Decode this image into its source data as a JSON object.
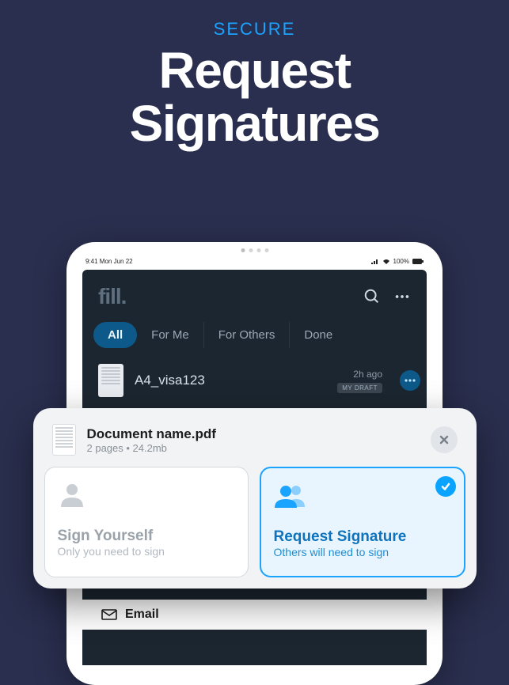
{
  "headline": {
    "eyebrow": "SECURE",
    "line1": "Request",
    "line2": "Signatures"
  },
  "statusbar": {
    "time": "9:41  Mon Jun 22",
    "battery": "100%"
  },
  "app": {
    "brand": "fill",
    "brandDot": "."
  },
  "tabs": [
    "All",
    "For Me",
    "For Others",
    "Done"
  ],
  "doc_row": {
    "title": "A4_visa123",
    "time": "2h ago",
    "badge": "MY DRAFT"
  },
  "sheet": {
    "title": "Document name.pdf",
    "subtitle": "2 pages • 24.2mb"
  },
  "options": {
    "sign": {
      "title": "Sign Yourself",
      "sub": "Only you need to sign"
    },
    "request": {
      "title": "Request Signature",
      "sub": "Others will need to sign"
    }
  },
  "email_label": "Email"
}
